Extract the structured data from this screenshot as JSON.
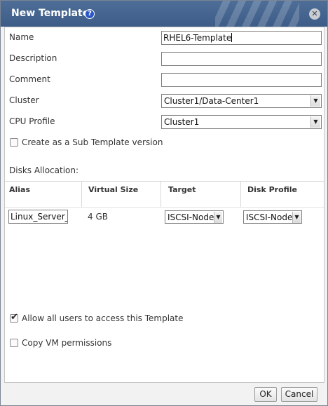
{
  "dialog": {
    "title": "New Template",
    "help_icon": "?",
    "close_icon": "✕"
  },
  "form": {
    "name_label": "Name",
    "name_value": "RHEL6-Template",
    "description_label": "Description",
    "description_value": "",
    "comment_label": "Comment",
    "comment_value": "",
    "cluster_label": "Cluster",
    "cluster_value": "Cluster1/Data-Center1",
    "cpu_profile_label": "CPU Profile",
    "cpu_profile_value": "Cluster1",
    "sub_template_label": "Create as a Sub Template version",
    "sub_template_checked": false
  },
  "disks": {
    "label": "Disks Allocation:",
    "columns": [
      "Alias",
      "Virtual Size",
      "Target",
      "Disk Profile"
    ],
    "rows": [
      {
        "alias": "Linux_Server_",
        "virtual_size": "4 GB",
        "target": "ISCSI-Node",
        "disk_profile": "ISCSI-Node"
      }
    ]
  },
  "permissions": {
    "allow_all_label": "Allow all users to access this Template",
    "allow_all_checked": true,
    "copy_vm_label": "Copy VM permissions",
    "copy_vm_checked": false
  },
  "footer": {
    "ok_label": "OK",
    "cancel_label": "Cancel"
  },
  "colors": {
    "titlebar": "#3d5d88",
    "help_icon": "#2a56c6"
  },
  "icons": {
    "help": "help-icon",
    "close": "close-icon",
    "dropdown": "chevron-down-icon",
    "check": "checkmark-icon"
  }
}
